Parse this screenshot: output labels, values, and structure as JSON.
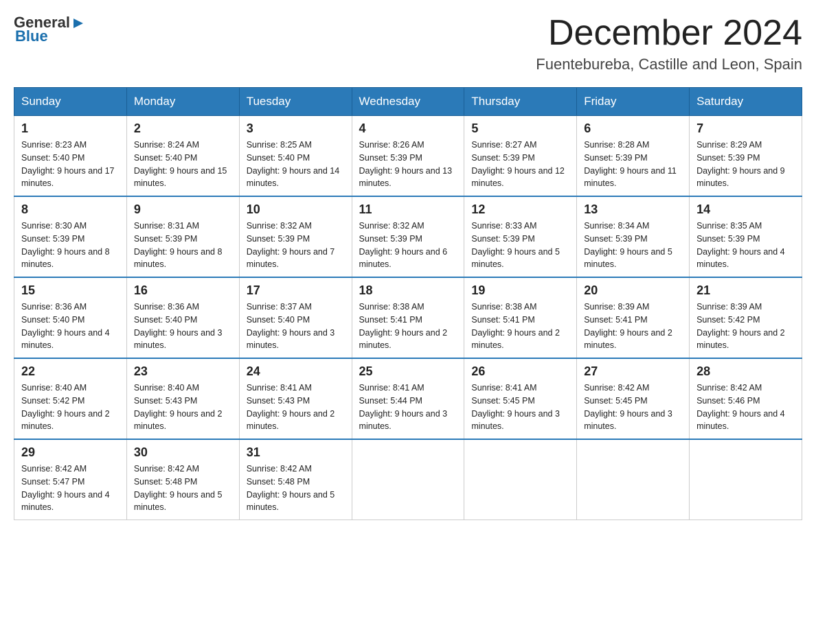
{
  "header": {
    "logo_general": "General",
    "logo_blue": "Blue",
    "month_year": "December 2024",
    "location": "Fuentebureba, Castille and Leon, Spain"
  },
  "weekdays": [
    "Sunday",
    "Monday",
    "Tuesday",
    "Wednesday",
    "Thursday",
    "Friday",
    "Saturday"
  ],
  "weeks": [
    [
      {
        "day": "1",
        "sunrise": "8:23 AM",
        "sunset": "5:40 PM",
        "daylight": "9 hours and 17 minutes."
      },
      {
        "day": "2",
        "sunrise": "8:24 AM",
        "sunset": "5:40 PM",
        "daylight": "9 hours and 15 minutes."
      },
      {
        "day": "3",
        "sunrise": "8:25 AM",
        "sunset": "5:40 PM",
        "daylight": "9 hours and 14 minutes."
      },
      {
        "day": "4",
        "sunrise": "8:26 AM",
        "sunset": "5:39 PM",
        "daylight": "9 hours and 13 minutes."
      },
      {
        "day": "5",
        "sunrise": "8:27 AM",
        "sunset": "5:39 PM",
        "daylight": "9 hours and 12 minutes."
      },
      {
        "day": "6",
        "sunrise": "8:28 AM",
        "sunset": "5:39 PM",
        "daylight": "9 hours and 11 minutes."
      },
      {
        "day": "7",
        "sunrise": "8:29 AM",
        "sunset": "5:39 PM",
        "daylight": "9 hours and 9 minutes."
      }
    ],
    [
      {
        "day": "8",
        "sunrise": "8:30 AM",
        "sunset": "5:39 PM",
        "daylight": "9 hours and 8 minutes."
      },
      {
        "day": "9",
        "sunrise": "8:31 AM",
        "sunset": "5:39 PM",
        "daylight": "9 hours and 8 minutes."
      },
      {
        "day": "10",
        "sunrise": "8:32 AM",
        "sunset": "5:39 PM",
        "daylight": "9 hours and 7 minutes."
      },
      {
        "day": "11",
        "sunrise": "8:32 AM",
        "sunset": "5:39 PM",
        "daylight": "9 hours and 6 minutes."
      },
      {
        "day": "12",
        "sunrise": "8:33 AM",
        "sunset": "5:39 PM",
        "daylight": "9 hours and 5 minutes."
      },
      {
        "day": "13",
        "sunrise": "8:34 AM",
        "sunset": "5:39 PM",
        "daylight": "9 hours and 5 minutes."
      },
      {
        "day": "14",
        "sunrise": "8:35 AM",
        "sunset": "5:39 PM",
        "daylight": "9 hours and 4 minutes."
      }
    ],
    [
      {
        "day": "15",
        "sunrise": "8:36 AM",
        "sunset": "5:40 PM",
        "daylight": "9 hours and 4 minutes."
      },
      {
        "day": "16",
        "sunrise": "8:36 AM",
        "sunset": "5:40 PM",
        "daylight": "9 hours and 3 minutes."
      },
      {
        "day": "17",
        "sunrise": "8:37 AM",
        "sunset": "5:40 PM",
        "daylight": "9 hours and 3 minutes."
      },
      {
        "day": "18",
        "sunrise": "8:38 AM",
        "sunset": "5:41 PM",
        "daylight": "9 hours and 2 minutes."
      },
      {
        "day": "19",
        "sunrise": "8:38 AM",
        "sunset": "5:41 PM",
        "daylight": "9 hours and 2 minutes."
      },
      {
        "day": "20",
        "sunrise": "8:39 AM",
        "sunset": "5:41 PM",
        "daylight": "9 hours and 2 minutes."
      },
      {
        "day": "21",
        "sunrise": "8:39 AM",
        "sunset": "5:42 PM",
        "daylight": "9 hours and 2 minutes."
      }
    ],
    [
      {
        "day": "22",
        "sunrise": "8:40 AM",
        "sunset": "5:42 PM",
        "daylight": "9 hours and 2 minutes."
      },
      {
        "day": "23",
        "sunrise": "8:40 AM",
        "sunset": "5:43 PM",
        "daylight": "9 hours and 2 minutes."
      },
      {
        "day": "24",
        "sunrise": "8:41 AM",
        "sunset": "5:43 PM",
        "daylight": "9 hours and 2 minutes."
      },
      {
        "day": "25",
        "sunrise": "8:41 AM",
        "sunset": "5:44 PM",
        "daylight": "9 hours and 3 minutes."
      },
      {
        "day": "26",
        "sunrise": "8:41 AM",
        "sunset": "5:45 PM",
        "daylight": "9 hours and 3 minutes."
      },
      {
        "day": "27",
        "sunrise": "8:42 AM",
        "sunset": "5:45 PM",
        "daylight": "9 hours and 3 minutes."
      },
      {
        "day": "28",
        "sunrise": "8:42 AM",
        "sunset": "5:46 PM",
        "daylight": "9 hours and 4 minutes."
      }
    ],
    [
      {
        "day": "29",
        "sunrise": "8:42 AM",
        "sunset": "5:47 PM",
        "daylight": "9 hours and 4 minutes."
      },
      {
        "day": "30",
        "sunrise": "8:42 AM",
        "sunset": "5:48 PM",
        "daylight": "9 hours and 5 minutes."
      },
      {
        "day": "31",
        "sunrise": "8:42 AM",
        "sunset": "5:48 PM",
        "daylight": "9 hours and 5 minutes."
      },
      null,
      null,
      null,
      null
    ]
  ]
}
